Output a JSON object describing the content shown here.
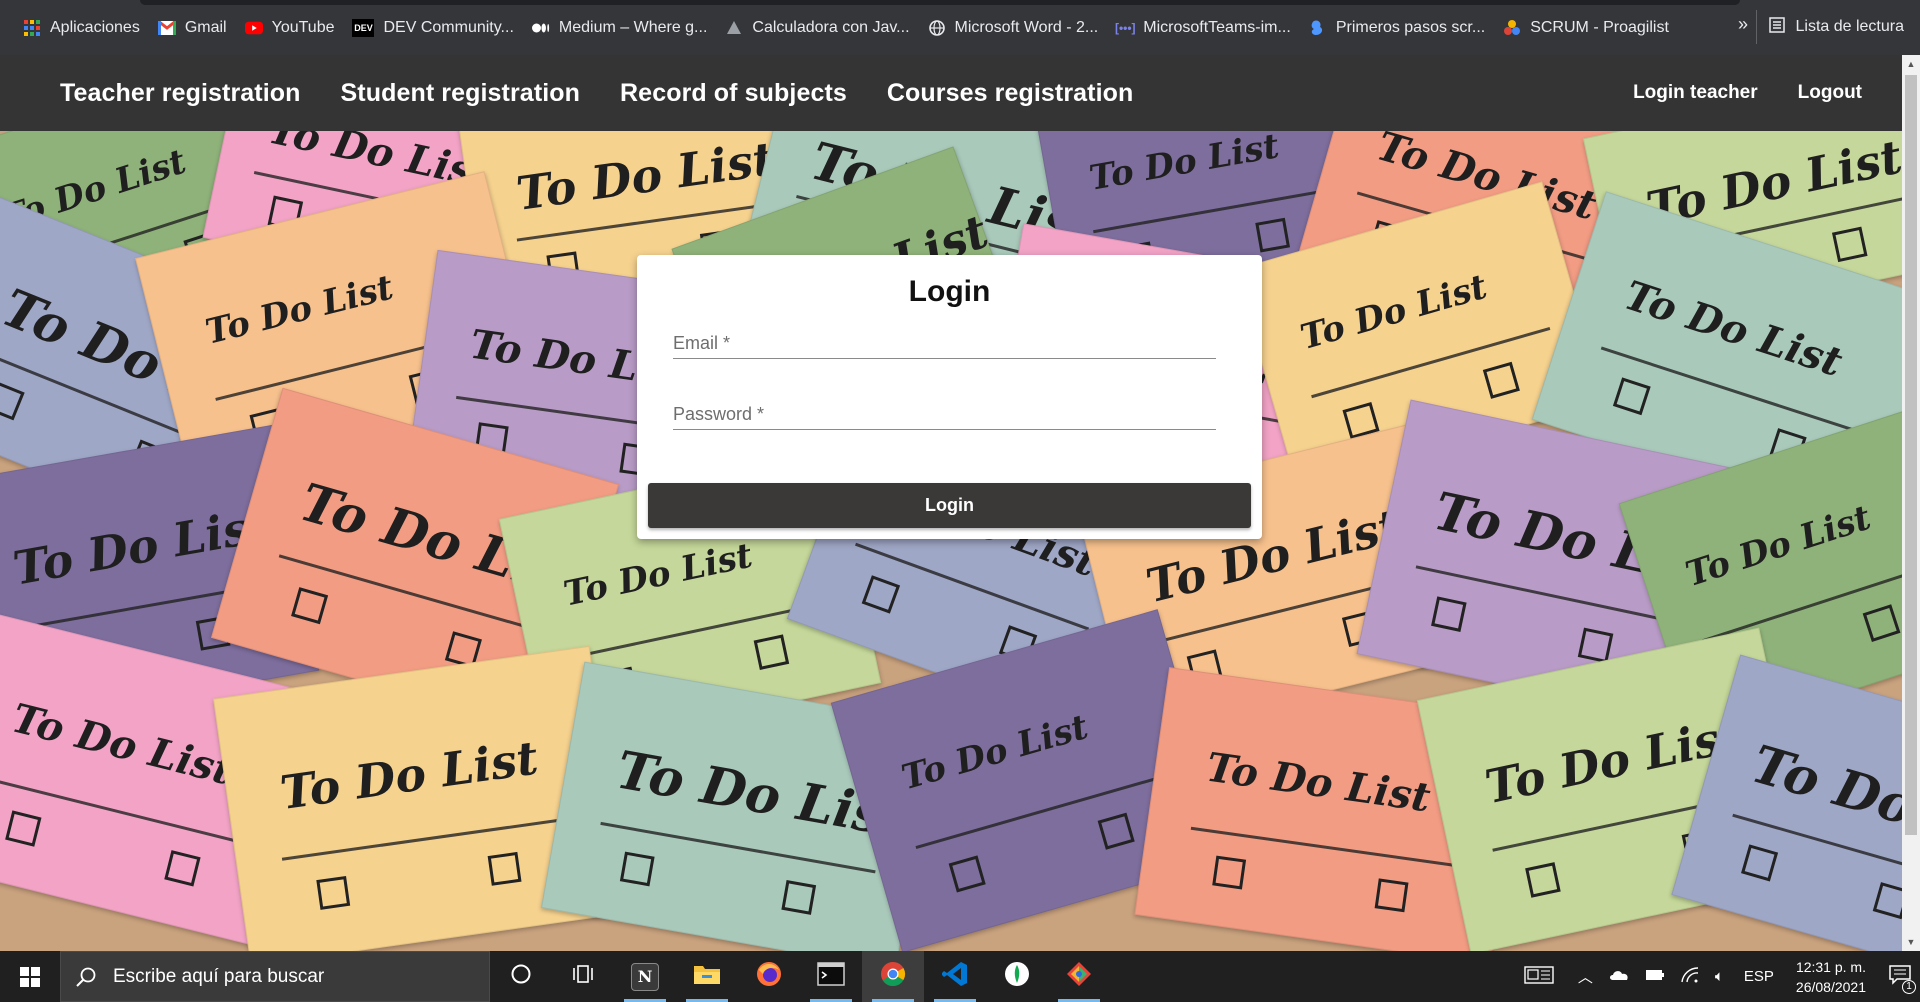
{
  "bookmarks": {
    "items": [
      {
        "label": "Aplicaciones",
        "icon": "apps-grid-icon",
        "color": "#4285f4"
      },
      {
        "label": "Gmail",
        "icon": "gmail-icon",
        "color": "#ea4335"
      },
      {
        "label": "YouTube",
        "icon": "youtube-icon",
        "color": "#ff0000"
      },
      {
        "label": "DEV Community...",
        "icon": "dev-icon",
        "color": "#000000"
      },
      {
        "label": "Medium – Where g...",
        "icon": "medium-icon",
        "color": "#000000"
      },
      {
        "label": "Calculadora con Jav...",
        "icon": "calculator-icon",
        "color": "#9aa0a6"
      },
      {
        "label": "Microsoft Word - 2...",
        "icon": "globe-icon",
        "color": "#e8eaed"
      },
      {
        "label": "MicrosoftTeams-im...",
        "icon": "teams-icon",
        "color": "#5b5fc7"
      },
      {
        "label": "Primeros pasos scr...",
        "icon": "scratch-icon",
        "color": "#4d97ff"
      },
      {
        "label": "SCRUM - Proagilist",
        "icon": "scrum-icon",
        "color": "#f4b400"
      }
    ],
    "more_label": "»",
    "reading_list_label": "Lista de lectura"
  },
  "navbar": {
    "links": [
      "Teacher registration",
      "Student registration",
      "Record of subjects",
      "Courses registration"
    ],
    "right_links": [
      "Login teacher",
      "Logout"
    ]
  },
  "login": {
    "title": "Login",
    "email_placeholder": "Email *",
    "password_placeholder": "Password *",
    "button_label": "Login"
  },
  "background_notes_text": "To Do List",
  "taskbar": {
    "search_placeholder": "Escribe aquí para buscar",
    "apps": [
      "cortana-icon",
      "task-view-icon",
      "notion-icon",
      "file-explorer-icon",
      "firefox-icon",
      "terminal-icon",
      "chrome-icon",
      "vscode-icon",
      "mongodb-compass-icon",
      "git-kraken-icon"
    ],
    "language": "ESP",
    "time": "12:31 p. m.",
    "date": "26/08/2021",
    "notification_count": "1"
  },
  "colors": {
    "navbar": "#343434",
    "button": "#3b3838",
    "card": "#ffffff"
  }
}
